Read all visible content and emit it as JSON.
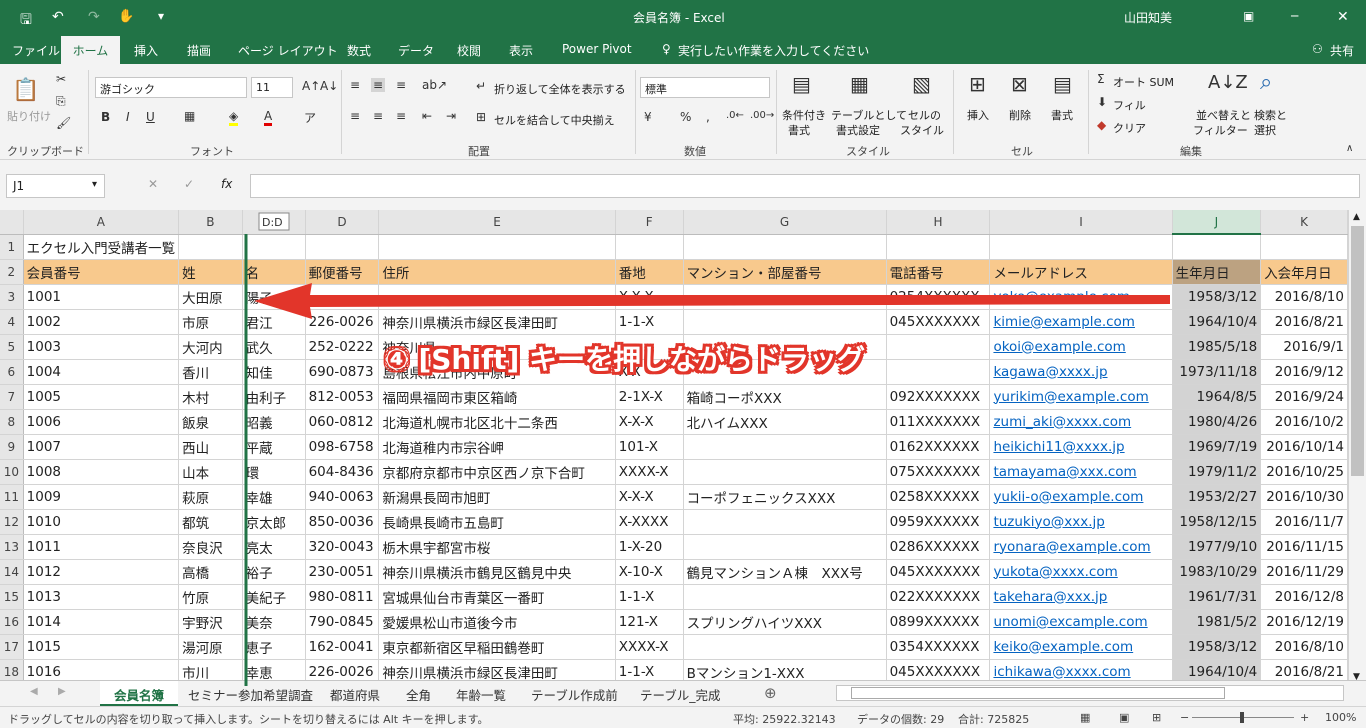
{
  "title_bar": {
    "title": "会員名簿 - Excel",
    "user": "山田知美"
  },
  "menu": [
    "ファイル",
    "ホーム",
    "挿入",
    "描画",
    "ページ レイアウト",
    "数式",
    "データ",
    "校閲",
    "表示",
    "Power Pivot",
    "実行したい作業を入力してください",
    "共有"
  ],
  "ribbon": {
    "paste": "貼り付け",
    "clipboard": "クリップボード",
    "font_name": "游ゴシック",
    "font_size": "11",
    "font_group": "フォント",
    "wrap": "折り返して全体を表示する",
    "merge": "セルを結合して中央揃え",
    "align_group": "配置",
    "number_format": "標準",
    "number_group": "数値",
    "cond": "条件付き",
    "cond2": "書式",
    "table": "テーブルとして",
    "table2": "書式設定",
    "cellstyle": "セルの",
    "cellstyle2": "スタイル",
    "style_group": "スタイル",
    "insert": "挿入",
    "delete": "削除",
    "format": "書式",
    "cell_group": "セル",
    "autosum": "オート SUM",
    "fill": "フィル",
    "clear": "クリア",
    "sort": "並べ替えと",
    "sort2": "フィルター",
    "find": "検索と",
    "find2": "選択",
    "edit_group": "編集"
  },
  "formula_bar": {
    "name_box": "J1",
    "fx": "fx",
    "tooltip": "D:D"
  },
  "columns": [
    "A",
    "B",
    "C",
    "D",
    "E",
    "F",
    "G",
    "H",
    "I",
    "J",
    "K"
  ],
  "rows": [
    {
      "n": "1",
      "cells": [
        "エクセル入門受講者一覧",
        "",
        "",
        "",
        "",
        "",
        "",
        "",
        "",
        "",
        ""
      ]
    },
    {
      "n": "2",
      "cells": [
        "会員番号",
        "姓",
        "名",
        "郵便番号",
        "住所",
        "番地",
        "マンション・部屋番号",
        "電話番号",
        "メールアドレス",
        "生年月日",
        "入会年月日"
      ]
    },
    {
      "n": "3",
      "cells": [
        "1001",
        "大田原",
        "陽子",
        "",
        "",
        "X-X-X",
        "",
        "0254XXXXXX",
        "yoko@example.com",
        "1958/3/12",
        "2016/8/10"
      ]
    },
    {
      "n": "4",
      "cells": [
        "1002",
        "市原",
        "君江",
        "226-0026",
        "神奈川県横浜市緑区長津田町",
        "1-1-X",
        "",
        "045XXXXXXX",
        "kimie@example.com",
        "1964/10/4",
        "2016/8/21"
      ]
    },
    {
      "n": "5",
      "cells": [
        "1003",
        "大河内",
        "武久",
        "252-0222",
        "神奈川県",
        "",
        "",
        "",
        "okoi@example.com",
        "1985/5/18",
        "2016/9/1"
      ]
    },
    {
      "n": "6",
      "cells": [
        "1004",
        "香川",
        "知佳",
        "690-0873",
        "島根県松江市内中原町",
        "X-X",
        "",
        "",
        "kagawa@xxxx.jp",
        "1973/11/18",
        "2016/9/12"
      ]
    },
    {
      "n": "7",
      "cells": [
        "1005",
        "木村",
        "由利子",
        "812-0053",
        "福岡県福岡市東区箱崎",
        "2-1X-X",
        "箱崎コーポXXX",
        "092XXXXXXX",
        "yurikim@example.com",
        "1964/8/5",
        "2016/9/24"
      ]
    },
    {
      "n": "8",
      "cells": [
        "1006",
        "飯泉",
        "昭義",
        "060-0812",
        "北海道札幌市北区北十二条西",
        "X-X-X",
        "北ハイムXXX",
        "011XXXXXXX",
        "zumi_aki@xxxx.com",
        "1980/4/26",
        "2016/10/2"
      ]
    },
    {
      "n": "9",
      "cells": [
        "1007",
        "西山",
        "平蔵",
        "098-6758",
        "北海道稚内市宗谷岬",
        "101-X",
        "",
        "0162XXXXXX",
        "heikichi11@xxxx.jp",
        "1969/7/19",
        "2016/10/14"
      ]
    },
    {
      "n": "10",
      "cells": [
        "1008",
        "山本",
        "環",
        "604-8436",
        "京都府京都市中京区西ノ京下合町",
        "XXXX-X",
        "",
        "075XXXXXXX",
        "tamayama@xxx.com",
        "1979/11/2",
        "2016/10/25"
      ]
    },
    {
      "n": "11",
      "cells": [
        "1009",
        "萩原",
        "幸雄",
        "940-0063",
        "新潟県長岡市旭町",
        "X-X-X",
        "コーポフェニックスXXX",
        "0258XXXXXX",
        "yukii-o@example.com",
        "1953/2/27",
        "2016/10/30"
      ]
    },
    {
      "n": "12",
      "cells": [
        "1010",
        "都筑",
        "京太郎",
        "850-0036",
        "長崎県長崎市五島町",
        "X-XXXX",
        "",
        "0959XXXXXX",
        "tuzukiyo@xxx.jp",
        "1958/12/15",
        "2016/11/7"
      ]
    },
    {
      "n": "13",
      "cells": [
        "1011",
        "奈良沢",
        "亮太",
        "320-0043",
        "栃木県宇都宮市桜",
        "1-X-20",
        "",
        "0286XXXXXX",
        "ryonara@example.com",
        "1977/9/10",
        "2016/11/15"
      ]
    },
    {
      "n": "14",
      "cells": [
        "1012",
        "高橋",
        "裕子",
        "230-0051",
        "神奈川県横浜市鶴見区鶴見中央",
        "X-10-X",
        "鶴見マンションＡ棟　XXX号",
        "045XXXXXXX",
        "yukota@xxxx.com",
        "1983/10/29",
        "2016/11/29"
      ]
    },
    {
      "n": "15",
      "cells": [
        "1013",
        "竹原",
        "美紀子",
        "980-0811",
        "宮城県仙台市青葉区一番町",
        "1-1-X",
        "",
        "022XXXXXXX",
        "takehara@xxx.jp",
        "1961/7/31",
        "2016/12/8"
      ]
    },
    {
      "n": "16",
      "cells": [
        "1014",
        "宇野沢",
        "美奈",
        "790-0845",
        "愛媛県松山市道後今市",
        "121-X",
        "スプリングハイツXXX",
        "0899XXXXXX",
        "unomi@excample.com",
        "1981/5/2",
        "2016/12/19"
      ]
    },
    {
      "n": "17",
      "cells": [
        "1015",
        "湯河原",
        "恵子",
        "162-0041",
        "東京都新宿区早稲田鶴巻町",
        "XXXX-X",
        "",
        "0354XXXXXX",
        "keiko@example.com",
        "1958/3/12",
        "2016/8/10"
      ]
    },
    {
      "n": "18",
      "cells": [
        "1016",
        "市川",
        "幸恵",
        "226-0026",
        "神奈川県横浜市緑区長津田町",
        "1-1-X",
        "Bマンション1-XXX",
        "045XXXXXXX",
        "ichikawa@xxxx.com",
        "1964/10/4",
        "2016/8/21"
      ]
    }
  ],
  "sheet_tabs": [
    "会員名簿",
    "セミナー参加希望調査",
    "都道府県",
    "全角",
    "年齢一覧",
    "テーブル作成前",
    "テーブル_完成"
  ],
  "status_bar": {
    "message": "ドラッグしてセルの内容を切り取って挿入します。シートを切り替えるには Alt キーを押します。",
    "average": "平均: 25922.32143",
    "count": "データの個数: 29",
    "sum": "合計: 725825",
    "zoom": "100%"
  },
  "annotation": {
    "text": "④ [Shift] キーを押しながらドラッグ",
    "color": "#e2352a"
  }
}
